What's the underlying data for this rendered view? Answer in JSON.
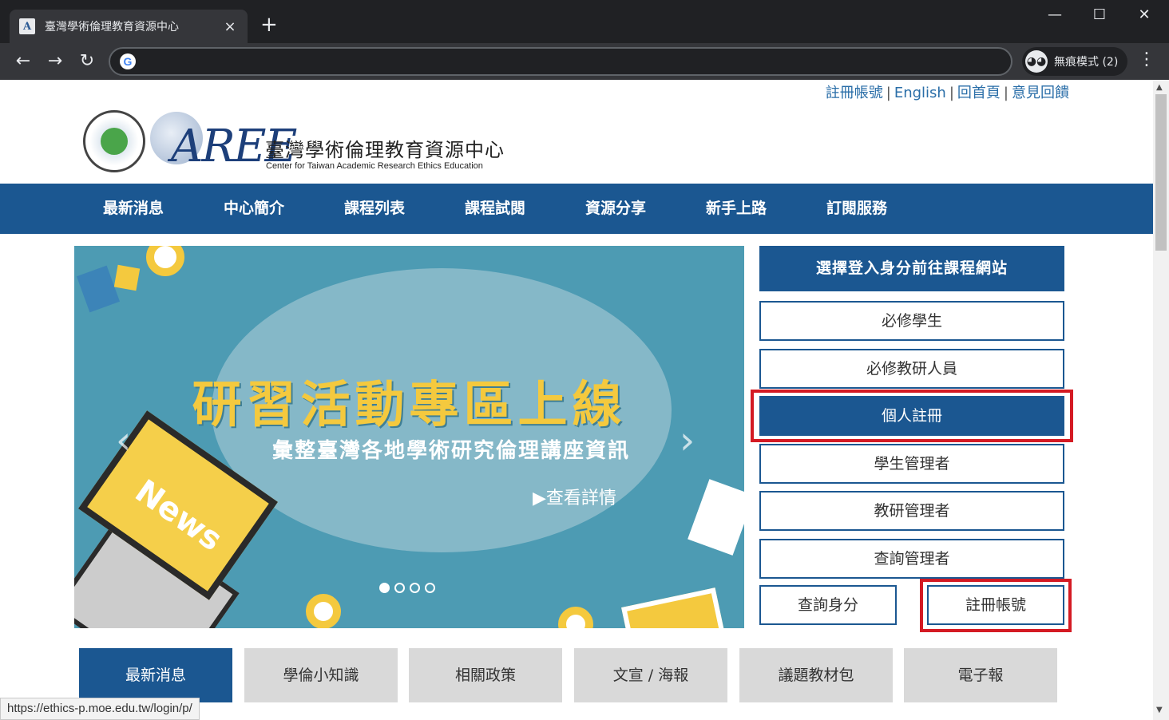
{
  "browser": {
    "tab_title": "臺灣學術倫理教育資源中心",
    "tab_favicon_text": "A",
    "tab_close": "×",
    "new_tab": "+",
    "minimize": "—",
    "maximize": "☐",
    "close": "✕",
    "back": "←",
    "forward": "→",
    "reload": "↻",
    "address_icon": "G",
    "address_value": "",
    "incognito_label": "無痕模式 (2)",
    "incognito_icon": "spy-icon",
    "menu": "⋮",
    "status_url": "https://ethics-p.moe.edu.tw/login/p/"
  },
  "toplinks": [
    "註冊帳號",
    "English",
    "回首頁",
    "意見回饋"
  ],
  "toplinks_sep": "|",
  "header": {
    "aree": "AREE",
    "title": "臺灣學術倫理教育資源中心",
    "subtitle": "Center for Taiwan Academic Research Ethics Education"
  },
  "mainnav": [
    "最新消息",
    "中心簡介",
    "課程列表",
    "課程試閱",
    "資源分享",
    "新手上路",
    "訂閱服務"
  ],
  "banner": {
    "title": "研習活動專區上線",
    "subtitle": "彙整臺灣各地學術研究倫理講座資訊",
    "more": "▶查看詳情",
    "prev": "‹",
    "next": "›",
    "laptop_text": "News",
    "slide_count": 4,
    "active_slide": 1,
    "colors": {
      "background": "#4d9bb3",
      "bubble": "#85b8c8",
      "title": "#f4c93e"
    }
  },
  "side": {
    "header": "選擇登入身分前往課程網站",
    "buttons": [
      "必修學生",
      "必修教研人員",
      "個人註冊",
      "學生管理者",
      "教研管理者",
      "查詢管理者"
    ],
    "bottom_left": "查詢身分",
    "bottom_right": "註冊帳號"
  },
  "categories": [
    "最新消息",
    "學倫小知識",
    "相關政策",
    "文宣 / 海報",
    "議題教材包",
    "電子報"
  ],
  "colors": {
    "brand": "#1b5791",
    "highlight": "#d41a23",
    "link": "#2a6ea8",
    "tab_inactive": "#d9d9d9"
  }
}
